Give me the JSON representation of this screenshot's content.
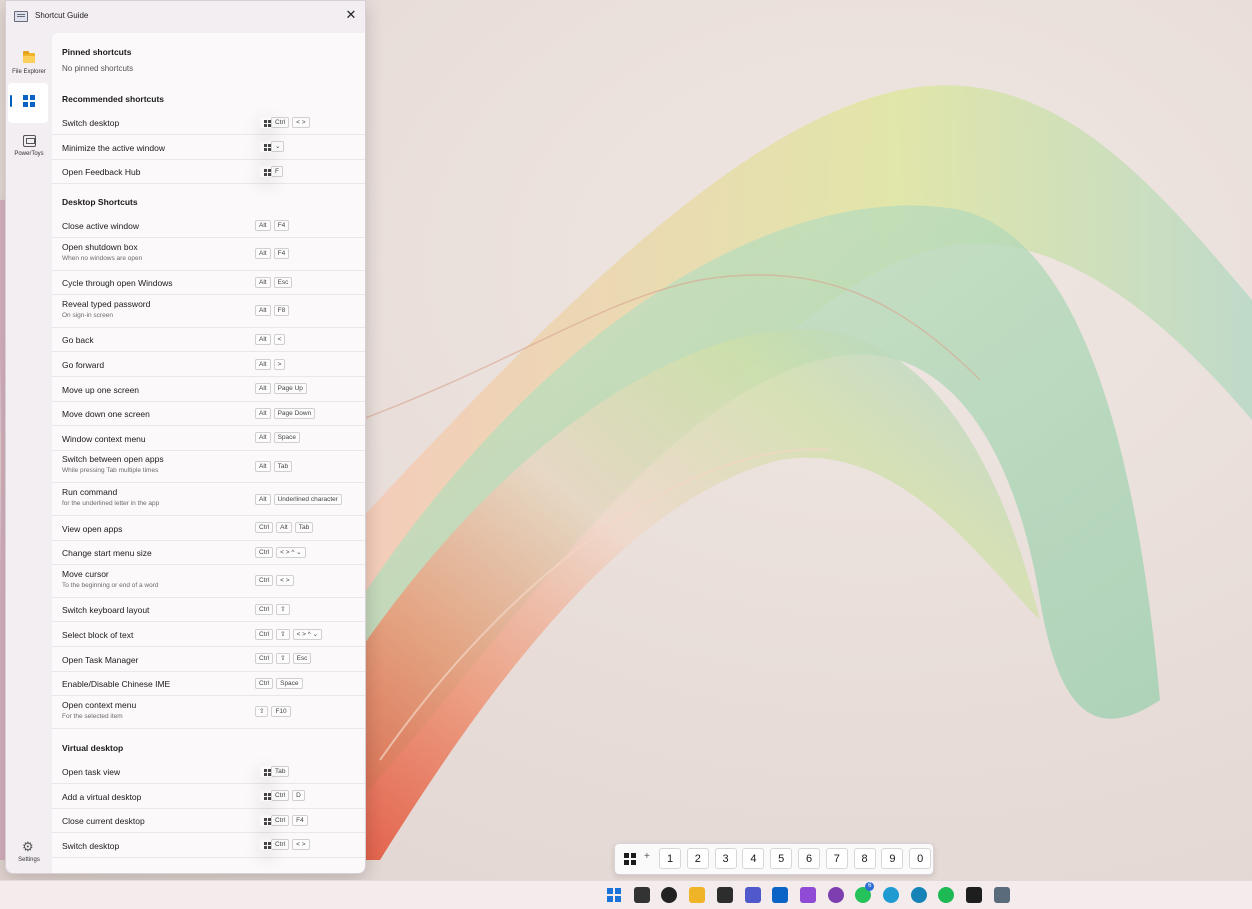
{
  "window": {
    "title": "Shortcut Guide",
    "close_glyph": "✕"
  },
  "sidebar": {
    "items": [
      {
        "label": "File Explorer",
        "icon": "folder-icon"
      },
      {
        "label": "",
        "icon": "windows-icon",
        "selected": true
      },
      {
        "label": "PowerToys",
        "icon": "powertoys-icon"
      }
    ],
    "settings_label": "Settings"
  },
  "pinned": {
    "title": "Pinned shortcuts",
    "empty_text": "No pinned shortcuts"
  },
  "recommended": {
    "title": "Recommended shortcuts",
    "rows": [
      {
        "name": "Switch desktop",
        "keys": [
          "Win",
          "Ctrl",
          "< >"
        ]
      },
      {
        "name": "Minimize the active window",
        "keys": [
          "Win",
          "⌄"
        ]
      },
      {
        "name": "Open Feedback Hub",
        "keys": [
          "Win",
          "F"
        ]
      }
    ]
  },
  "desktop": {
    "title": "Desktop Shortcuts",
    "rows": [
      {
        "name": "Close active window",
        "keys": [
          "Alt",
          "F4"
        ]
      },
      {
        "name": "Open shutdown box",
        "sub": "When no windows are open",
        "keys": [
          "Alt",
          "F4"
        ]
      },
      {
        "name": "Cycle through open Windows",
        "keys": [
          "Alt",
          "Esc"
        ]
      },
      {
        "name": "Reveal typed password",
        "sub": "On sign-in screen",
        "keys": [
          "Alt",
          "F8"
        ]
      },
      {
        "name": "Go back",
        "keys": [
          "Alt",
          "<"
        ]
      },
      {
        "name": "Go forward",
        "keys": [
          "Alt",
          ">"
        ]
      },
      {
        "name": "Move up one screen",
        "keys": [
          "Alt",
          "Page Up"
        ]
      },
      {
        "name": "Move down one screen",
        "keys": [
          "Alt",
          "Page Down"
        ]
      },
      {
        "name": "Window context menu",
        "keys": [
          "Alt",
          "Space"
        ]
      },
      {
        "name": "Switch between open apps",
        "sub": "While pressing Tab multiple times",
        "keys": [
          "Alt",
          "Tab"
        ]
      },
      {
        "name": "Run command",
        "sub": "for the underlined letter in the app",
        "keys": [
          "Alt",
          "Underlined character"
        ]
      },
      {
        "name": "View open apps",
        "keys": [
          "Ctrl",
          "Alt",
          "Tab"
        ]
      },
      {
        "name": "Change start menu size",
        "keys": [
          "Ctrl",
          "< > ^ ⌄"
        ]
      },
      {
        "name": "Move cursor",
        "sub": "To the beginning or end of a word",
        "keys": [
          "Ctrl",
          "< >"
        ]
      },
      {
        "name": "Switch keyboard layout",
        "keys": [
          "Ctrl",
          "⇧"
        ]
      },
      {
        "name": "Select block of text",
        "keys": [
          "Ctrl",
          "⇧",
          "< > ^ ⌄"
        ]
      },
      {
        "name": "Open Task Manager",
        "keys": [
          "Ctrl",
          "⇧",
          "Esc"
        ]
      },
      {
        "name": "Enable/Disable Chinese IME",
        "keys": [
          "Ctrl",
          "Space"
        ]
      },
      {
        "name": "Open context menu",
        "sub": "For the selected item",
        "keys": [
          "⇧",
          "F10"
        ]
      }
    ]
  },
  "virtual": {
    "title": "Virtual desktop",
    "rows": [
      {
        "name": "Open task view",
        "keys": [
          "Win",
          "Tab"
        ]
      },
      {
        "name": "Add a virtual desktop",
        "keys": [
          "Win",
          "Ctrl",
          "D"
        ]
      },
      {
        "name": "Close current desktop",
        "keys": [
          "Win",
          "Ctrl",
          "F4"
        ]
      },
      {
        "name": "Switch desktop",
        "keys": [
          "Win",
          "Ctrl",
          "< >"
        ]
      }
    ]
  },
  "numbar": {
    "plus": "+",
    "keys": [
      "1",
      "2",
      "3",
      "4",
      "5",
      "6",
      "7",
      "8",
      "9",
      "0"
    ]
  },
  "taskbar": {
    "icons": [
      {
        "name": "start-icon",
        "color": "#1a73d9"
      },
      {
        "name": "task-view-icon",
        "color": "#333333"
      },
      {
        "name": "chatgpt-icon",
        "color": "#222222"
      },
      {
        "name": "file-explorer-icon",
        "color": "#f0b429"
      },
      {
        "name": "terminal-icon",
        "color": "#2d2d2d"
      },
      {
        "name": "teams-icon",
        "color": "#5059c9"
      },
      {
        "name": "outlook-icon",
        "color": "#0a64c8"
      },
      {
        "name": "visual-studio-icon",
        "color": "#8f4bd6"
      },
      {
        "name": "github-desktop-icon",
        "color": "#7d3fb0"
      },
      {
        "name": "whatsapp-icon",
        "color": "#25c25c",
        "badge": "6"
      },
      {
        "name": "edge-icon",
        "color": "#1f9bd1"
      },
      {
        "name": "edge-dev-icon",
        "color": "#1583b8"
      },
      {
        "name": "spotify-icon",
        "color": "#1db954"
      },
      {
        "name": "figma-icon",
        "color": "#1e1e1e"
      },
      {
        "name": "settings-icon",
        "color": "#5a6b7c"
      }
    ]
  }
}
